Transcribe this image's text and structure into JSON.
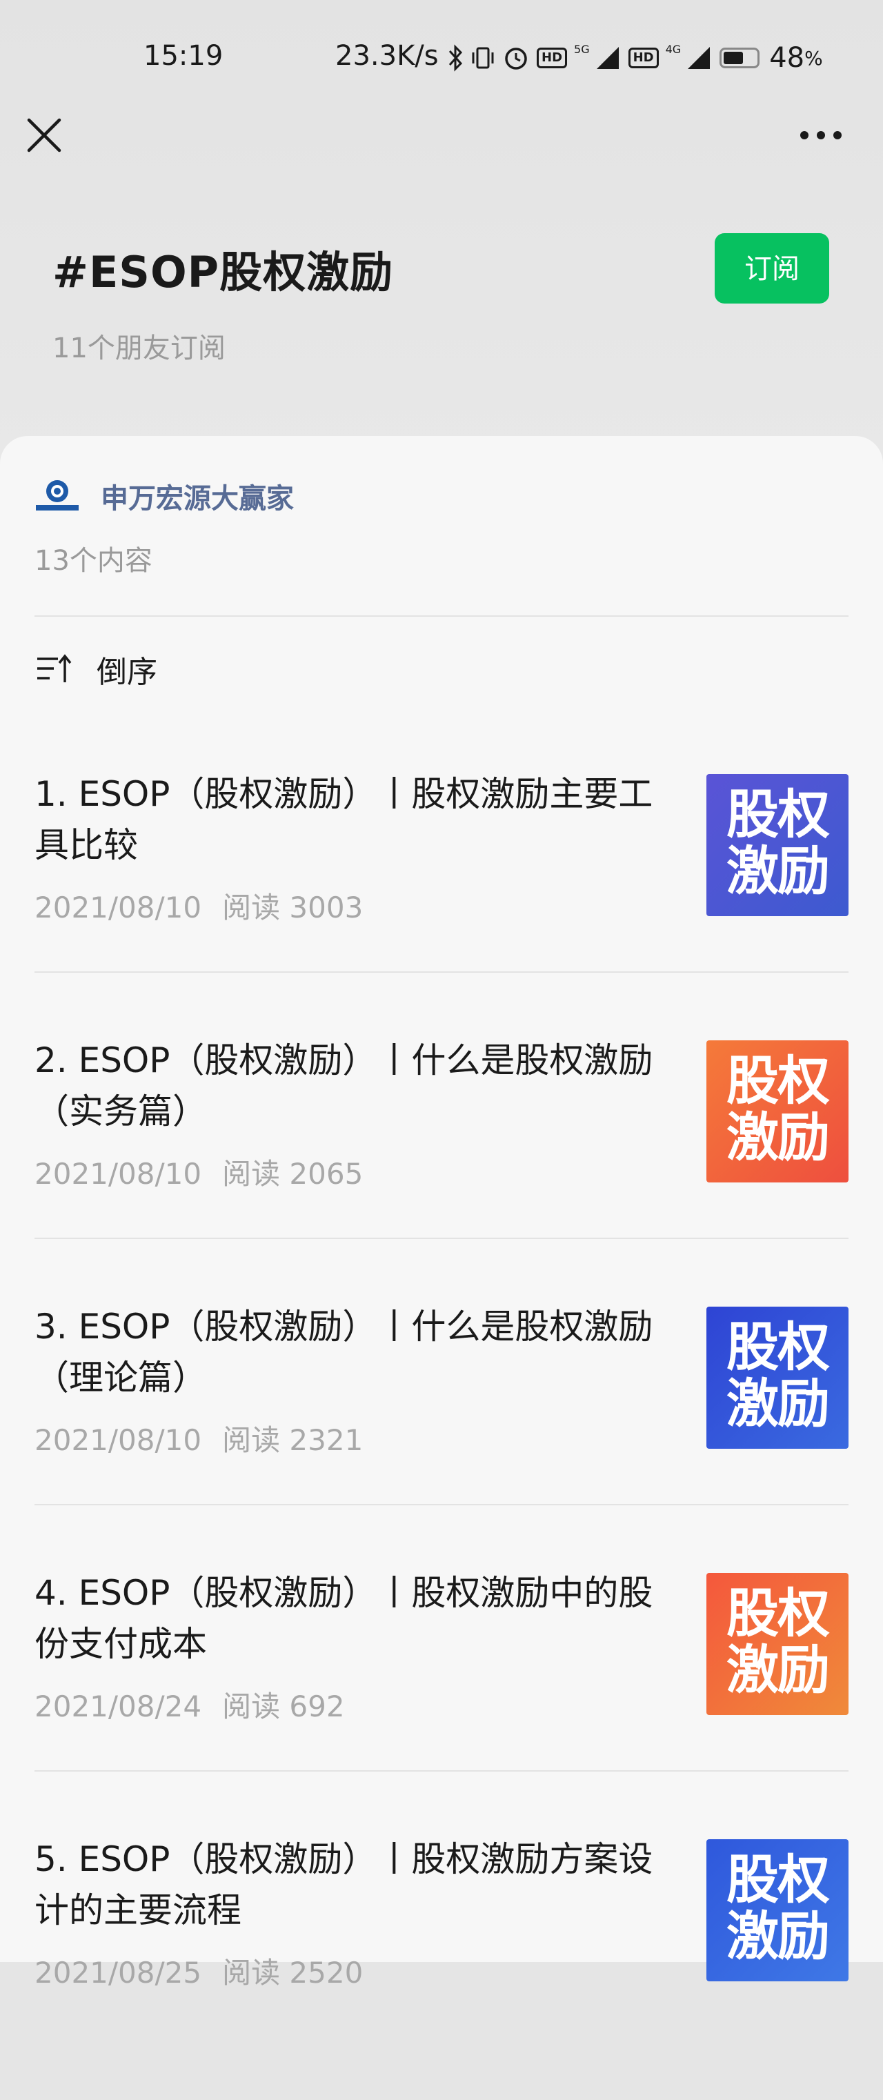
{
  "status_bar": {
    "time": "15:19",
    "network_speed": "23.3K/s",
    "battery_level": "48",
    "battery_unit": "%",
    "network_5g": "5G",
    "network_4g": "4G",
    "hd_label": "HD"
  },
  "nav": {
    "close_icon": "close-icon",
    "more_icon": "more-icon"
  },
  "header": {
    "title": "#ESOP股权激励",
    "subscribe_label": "订阅",
    "subscriber_count": "11个朋友订阅"
  },
  "source": {
    "name": "申万宏源大赢家",
    "content_count": "13个内容"
  },
  "sort": {
    "label": "倒序"
  },
  "articles": [
    {
      "title": "1. ESOP（股权激励）丨股权激励主要工具比较",
      "date": "2021/08/10",
      "reads": "阅读 3003",
      "thumb_text": "股权激励",
      "thumb_color": "#4a56c8"
    },
    {
      "title": "2. ESOP（股权激励）丨什么是股权激励（实务篇）",
      "date": "2021/08/10",
      "reads": "阅读 2065",
      "thumb_text": "股权激励",
      "thumb_color": "#f0653a"
    },
    {
      "title": "3. ESOP（股权激励）丨什么是股权激励（理论篇）",
      "date": "2021/08/10",
      "reads": "阅读 2321",
      "thumb_text": "股权激励",
      "thumb_color": "#3152d8"
    },
    {
      "title": "4. ESOP（股权激励）丨股权激励中的股份支付成本",
      "date": "2021/08/24",
      "reads": "阅读 692",
      "thumb_text": "股权激励",
      "thumb_color": "#f2693a"
    },
    {
      "title": "5. ESOP（股权激励）丨股权激励方案设计的主要流程",
      "date": "2021/08/25",
      "reads": "阅读 2520",
      "thumb_text": "股权激励",
      "thumb_color": "#3460e0"
    }
  ]
}
